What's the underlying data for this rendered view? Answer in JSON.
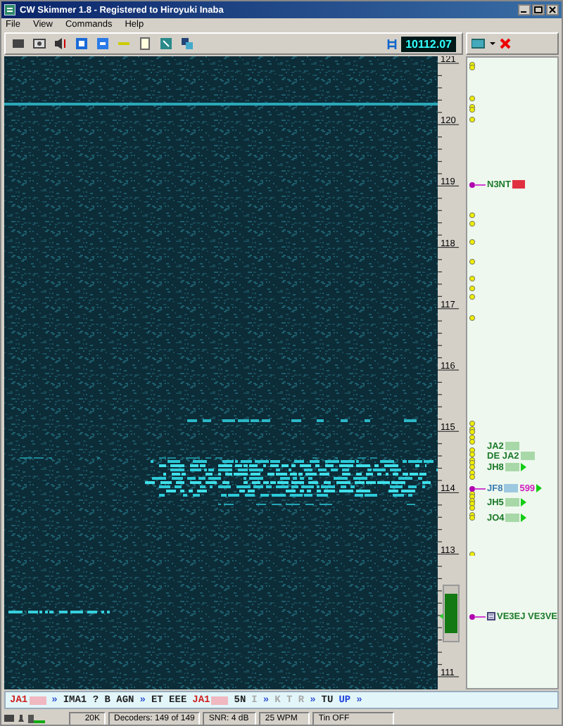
{
  "window": {
    "title": "CW Skimmer 1.8 - Registered to Hiroyuki Inaba"
  },
  "menu": [
    "File",
    "View",
    "Commands",
    "Help"
  ],
  "toolbar": {
    "frequency": "10112.07"
  },
  "scale": {
    "labels": [
      "121",
      "120",
      "119",
      "118",
      "117",
      "116",
      "115",
      "114",
      "113",
      "111"
    ]
  },
  "spots": [
    {
      "call": "N3NT",
      "masked": true,
      "color": "#e03040",
      "linked": true,
      "arrow": false,
      "note": false
    },
    {
      "call": "JA2",
      "masked": true,
      "color": "#a8d8a8",
      "linked": false,
      "arrow": false,
      "note": false
    },
    {
      "call": "DE JA2",
      "masked": true,
      "color": "#a8d8a8",
      "linked": false,
      "arrow": false,
      "note": false
    },
    {
      "call": "JH8",
      "masked": true,
      "color": "#a8d8a8",
      "linked": false,
      "arrow": true,
      "note": false
    },
    {
      "call": "JF8",
      "report": "599",
      "masked": true,
      "color": "#9cc8e0",
      "linked": true,
      "arrow": true,
      "note": false
    },
    {
      "call": "JH5",
      "masked": true,
      "color": "#a8d8a8",
      "linked": false,
      "arrow": true,
      "note": false
    },
    {
      "call": "JO4",
      "masked": true,
      "color": "#a8d8a8",
      "linked": false,
      "arrow": true,
      "note": false
    },
    {
      "call": "VE3EJ VE3VE",
      "masked": false,
      "linked": true,
      "arrow": false,
      "note": true
    }
  ],
  "decoded": [
    {
      "text": "JA1",
      "kind": "call",
      "masked": true
    },
    {
      "text": "»",
      "kind": "sep",
      "masked": false
    },
    {
      "text": "IMA1 ? B AGN",
      "kind": "word",
      "masked": false
    },
    {
      "text": "»",
      "kind": "sep",
      "masked": false
    },
    {
      "text": "ET EEE",
      "kind": "word",
      "masked": false
    },
    {
      "text": "JA1",
      "kind": "call",
      "masked": true
    },
    {
      "text": "5N",
      "kind": "word",
      "masked": false
    },
    {
      "text": "I",
      "kind": "faint",
      "masked": false
    },
    {
      "text": "»",
      "kind": "sep",
      "masked": false
    },
    {
      "text": "K T R",
      "kind": "faint",
      "masked": false
    },
    {
      "text": "»",
      "kind": "sep",
      "masked": false
    },
    {
      "text": "TU",
      "kind": "word",
      "masked": false
    },
    {
      "text": "UP",
      "kind": "accent",
      "masked": false
    },
    {
      "text": "»",
      "kind": "sep",
      "masked": false
    }
  ],
  "status": [
    "20K",
    "Decoders: 149 of 149",
    "SNR: 4 dB",
    "25 WPM",
    "Tin OFF"
  ]
}
